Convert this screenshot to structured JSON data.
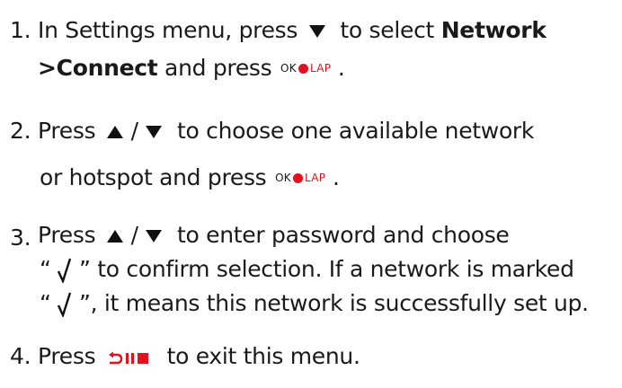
{
  "steps": [
    {
      "number": "1.",
      "lines": [
        {
          "a": "In Settings menu, press ",
          "b": " to select ",
          "bold": "Network"
        },
        {
          "bold": ">Connect",
          "a": " and press ",
          "end": " ."
        }
      ]
    },
    {
      "number": "2.",
      "lines": [
        {
          "a": "Press ",
          "sep": " / ",
          "b": " to choose one available network"
        },
        {
          "a": "or hotspot and press ",
          "end": " ."
        }
      ]
    },
    {
      "number": "3.",
      "lines": [
        {
          "a": "Press ",
          "sep": " / ",
          "b": " to enter password and choose"
        },
        {
          "q1": "“ ",
          "q2": " ” to confirm selection. If a network is marked"
        },
        {
          "q1": "“ ",
          "q2": " ”, it means this network is successfully set up."
        }
      ]
    },
    {
      "number": "4.",
      "lines": [
        {
          "a": "Press ",
          "b": " to exit this menu."
        }
      ]
    }
  ],
  "ok_button": {
    "ok": "OK",
    "lap": "LAP",
    "dot_color": "#e3101e"
  },
  "icons": {
    "down": "down-triangle-icon",
    "up": "up-triangle-icon",
    "check": "check-mark-icon",
    "back": "back-pause-stop-icon"
  },
  "colors": {
    "text": "#1a1a1a",
    "accent": "#e3101e"
  }
}
